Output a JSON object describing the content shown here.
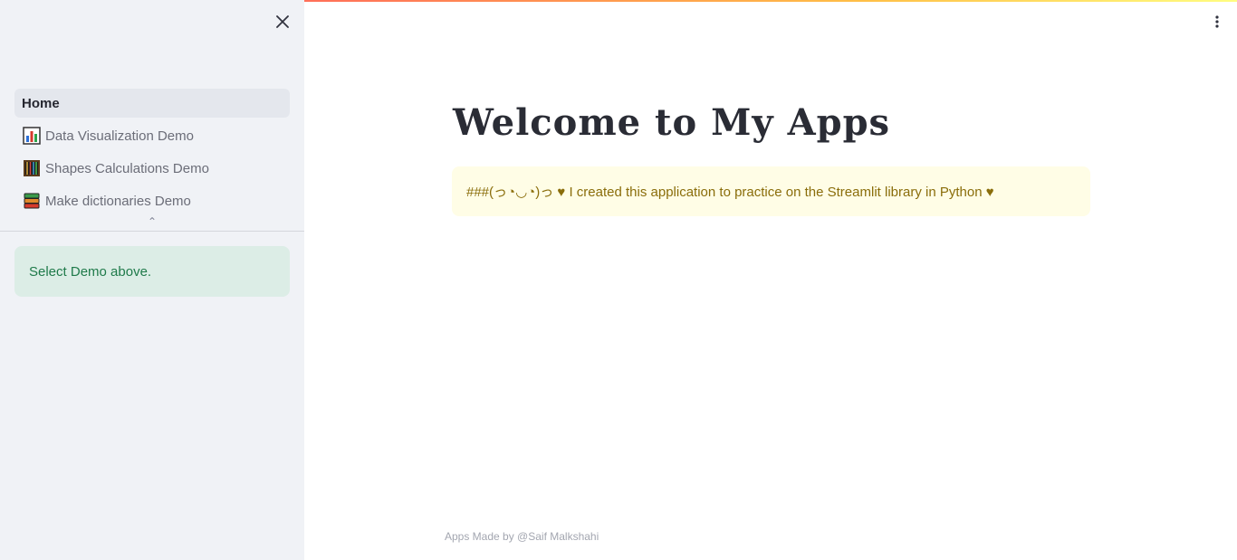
{
  "sidebar": {
    "nav": [
      {
        "label": "Home",
        "icon": "",
        "active": true
      },
      {
        "label": "Data Visualization Demo",
        "icon": "bar-chart-icon",
        "active": false
      },
      {
        "label": "Shapes Calculations Demo",
        "icon": "abacus-icon",
        "active": false
      },
      {
        "label": "Make dictionaries Demo",
        "icon": "books-icon",
        "active": false
      }
    ],
    "success_message": "Select Demo above."
  },
  "main": {
    "title": "Welcome to My Apps",
    "info_message": "###(っ◔◡◔)っ ♥ I created this application to practice on the Streamlit library in Python ♥",
    "footer": "Apps Made by @Saif Malkshahi"
  },
  "colors": {
    "sidebar_bg": "#f0f2f6",
    "success_bg": "#dcede6",
    "info_bg": "#fffde6",
    "accent_gradient": [
      "#ff6f59",
      "#ffbf47",
      "#fffd80"
    ]
  }
}
